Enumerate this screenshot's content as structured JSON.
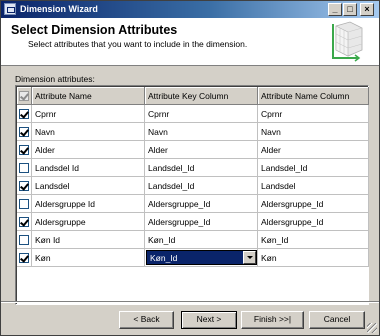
{
  "window": {
    "title": "Dimension Wizard"
  },
  "header": {
    "title": "Select Dimension Attributes",
    "subtitle": "Select attributes that you want to include in the dimension."
  },
  "grid": {
    "label": "Dimension attributes:",
    "select_all_checked": true,
    "columns": [
      "Attribute Name",
      "Attribute Key Column",
      "Attribute Name Column"
    ],
    "rows": [
      {
        "checked": true,
        "name": "Cprnr",
        "key": "Cprnr",
        "namecol": "Cprnr"
      },
      {
        "checked": true,
        "name": "Navn",
        "key": "Navn",
        "namecol": "Navn"
      },
      {
        "checked": true,
        "name": "Alder",
        "key": "Alder",
        "namecol": "Alder"
      },
      {
        "checked": false,
        "name": "Landsdel Id",
        "key": "Landsdel_Id",
        "namecol": "Landsdel_Id"
      },
      {
        "checked": true,
        "name": "Landsdel",
        "key": "Landsdel_Id",
        "namecol": "Landsdel"
      },
      {
        "checked": false,
        "name": "Aldersgruppe Id",
        "key": "Aldersgruppe_Id",
        "namecol": "Aldersgruppe_Id"
      },
      {
        "checked": true,
        "name": "Aldersgruppe",
        "key": "Aldersgruppe_Id",
        "namecol": "Aldersgruppe_Id"
      },
      {
        "checked": false,
        "name": "Køn Id",
        "key": "Køn_Id",
        "namecol": "Køn_Id"
      },
      {
        "checked": true,
        "name": "Køn",
        "key": "Køn_Id",
        "namecol": "Køn"
      }
    ],
    "active_key_value": "Køn_Id"
  },
  "buttons": {
    "back": "< Back",
    "next": "Next >",
    "finish": "Finish >>|",
    "cancel": "Cancel"
  },
  "titlebar_buttons": {
    "minimize": "_",
    "maximize": "□",
    "close": "×"
  },
  "colors": {
    "selection": "#0a246a",
    "titlebar_start": "#0a246a",
    "titlebar_end": "#a6caf0"
  }
}
